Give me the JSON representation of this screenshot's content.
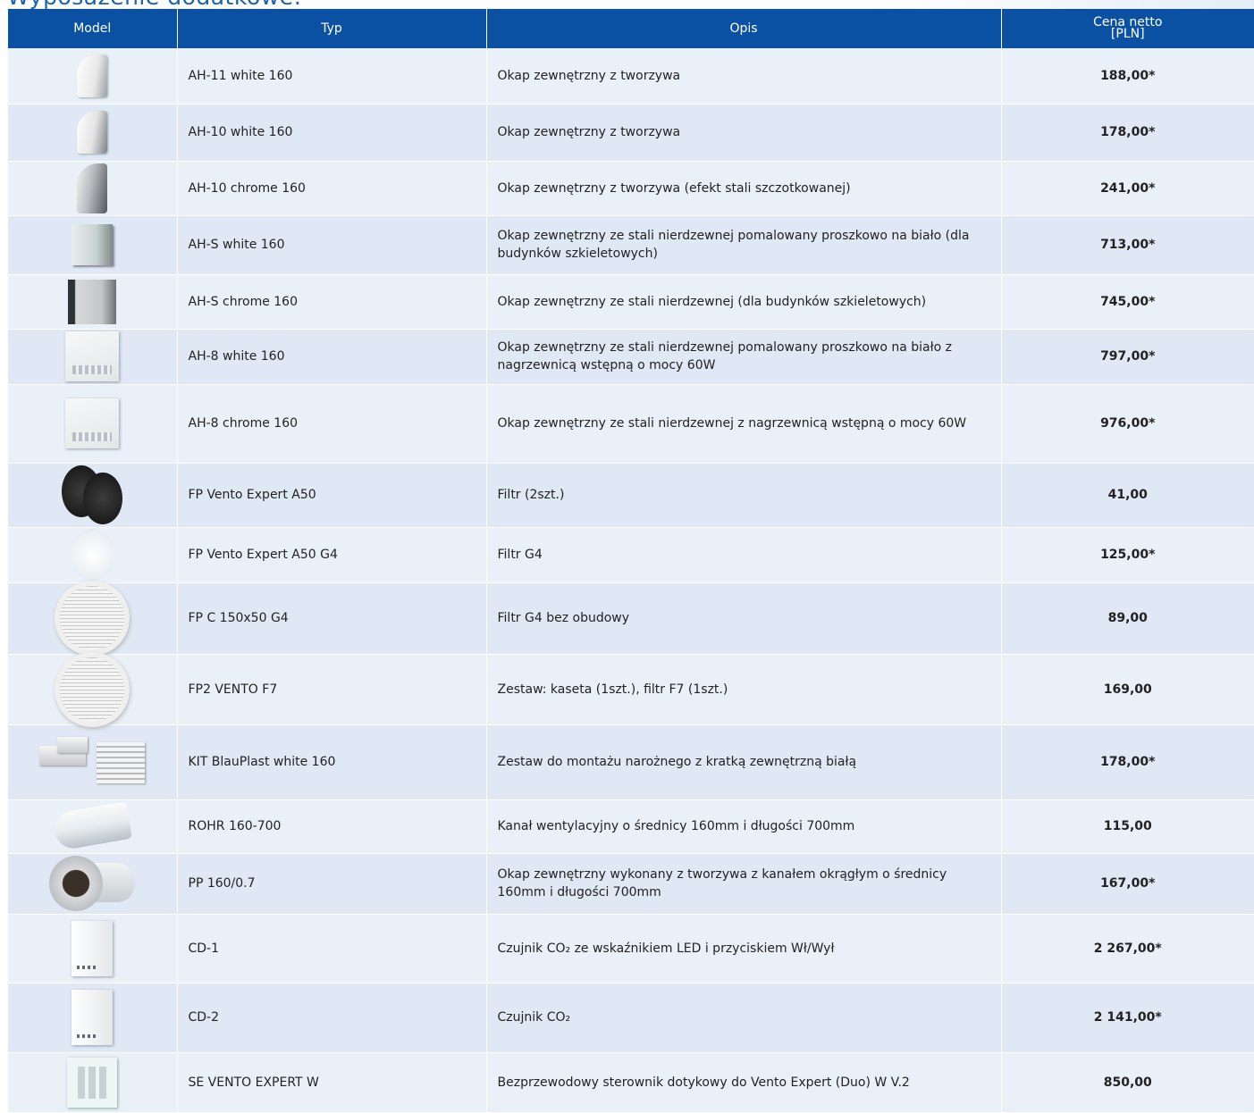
{
  "page": {
    "heading": "Wyposażenie dodatkowe:"
  },
  "table": {
    "headers": {
      "model": "Model",
      "type": "Typ",
      "description": "Opis",
      "price_line1": "Cena netto",
      "price_line2": "[PLN]"
    },
    "rows": [
      {
        "image_icon": "hood-plastic-icon",
        "type": "AH-11 white 160",
        "description": "Okap zewnętrzny z tworzywa",
        "price": "188,00*"
      },
      {
        "image_icon": "hood-plastic-grid-icon",
        "type": "AH-10 white 160",
        "description": "Okap zewnętrzny z tworzywa",
        "price": "178,00*"
      },
      {
        "image_icon": "hood-chrome-icon",
        "type": "AH-10 chrome 160",
        "description": "Okap zewnętrzny z tworzywa (efekt stali szczotkowanej)",
        "price": "241,00*"
      },
      {
        "image_icon": "box-hood-white-icon",
        "type": "AH-S white 160",
        "description": "Okap zewnętrzny ze stali nierdzewnej pomalowany proszkowo na biało (dla budynków szkieletowych)",
        "price": "713,00*"
      },
      {
        "image_icon": "box-hood-chrome-icon",
        "type": "AH-S chrome 160",
        "description": "Okap zewnętrzny ze stali nierdzewnej  (dla budynków szkieletowych)",
        "price": "745,00*"
      },
      {
        "image_icon": "hood-panel-white-icon",
        "type": "AH-8 white 160",
        "description": "Okap zewnętrzny ze stali nierdzewnej pomalowany proszkowo na biało z nagrzewnicą wstępną o mocy 60W",
        "price": "797,00*"
      },
      {
        "image_icon": "hood-panel-chrome-icon",
        "type": "AH-8 chrome 160",
        "description": "Okap zewnętrzny ze stali nierdzewnej  z nagrzewnicą wstępną o mocy 60W",
        "price": "976,00*"
      },
      {
        "image_icon": "filter-black-icon",
        "type": "FP Vento Expert A50",
        "description": "Filtr (2szt.)",
        "price": "41,00"
      },
      {
        "image_icon": "filter-white-icon",
        "type": "FP Vento Expert A50 G4",
        "description": "Filtr G4",
        "price": "125,00*"
      },
      {
        "image_icon": "round-grille-icon",
        "type": "FP C 150x50 G4",
        "description": "Filtr G4 bez obudowy",
        "price": "89,00"
      },
      {
        "image_icon": "cassette-filter-icon",
        "type": "FP2 VENTO F7",
        "description": "Zestaw: kaseta (1szt.), filtr F7 (1szt.)",
        "price": "169,00"
      },
      {
        "image_icon": "mounting-kit-icon",
        "type": "KIT BlauPlast white 160",
        "description": "Zestaw do montażu narożnego z kratką zewnętrzną białą",
        "price": "178,00*"
      },
      {
        "image_icon": "duct-tube-icon",
        "type": "ROHR 160-700",
        "description": "Kanał wentylacyjny o średnicy 160mm i długości 700mm",
        "price": "115,00"
      },
      {
        "image_icon": "hood-with-duct-icon",
        "type": "PP 160/0.7",
        "description": "Okap zewnętrzny wykonany z tworzywa z kanałem okrągłym o średnicy 160mm i długości 700mm",
        "price": "167,00*"
      },
      {
        "image_icon": "co2-sensor-led-icon",
        "type": "CD-1",
        "description": "Czujnik CO₂ ze wskaźnikiem LED i przyciskiem Wł/Wył",
        "price": "2 267,00*"
      },
      {
        "image_icon": "co2-sensor-icon",
        "type": "CD-2",
        "description": "Czujnik CO₂",
        "price": "2 141,00*"
      },
      {
        "image_icon": "touch-controller-icon",
        "type": "SE VENTO EXPERT W",
        "description": "Bezprzewodowy sterownik dotykowy do Vento Expert (Duo)  W V.2",
        "price": "850,00"
      }
    ]
  },
  "colors": {
    "header_bg": "#0a51a3",
    "row_odd": "#eaf0f8",
    "row_even": "#dfe8f4",
    "heading": "#1c63ad"
  }
}
